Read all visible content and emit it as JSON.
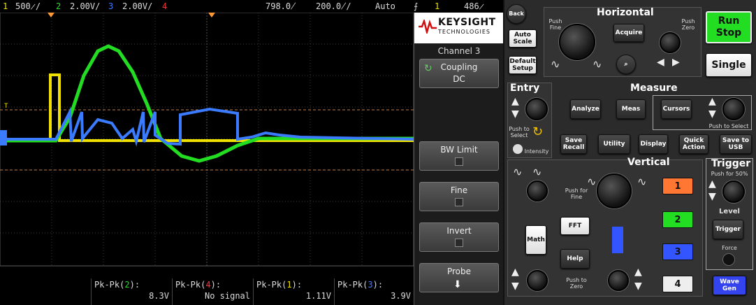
{
  "status": {
    "ch1": "1",
    "ch1_scale": "500̷/",
    "ch2": "2",
    "ch2_scale": "2.00V/",
    "ch3": "3",
    "ch3_scale": "2.00V/",
    "ch4": "4",
    "delay": "798.0̸",
    "timebase": "200.0̸/",
    "trigger_mode": "Auto",
    "trigger_icon": "⨍",
    "trigger_src": "1",
    "trigger_level": "486̷"
  },
  "measurements": [
    {
      "name_prefix": "Pk-Pk(",
      "ch": "2",
      "name_suffix": "):",
      "value": "8.3V"
    },
    {
      "name_prefix": "Pk-Pk(",
      "ch": "4",
      "name_suffix": "):",
      "value": "No signal"
    },
    {
      "name_prefix": "Pk-Pk(",
      "ch": "1",
      "name_suffix": "):",
      "value": "1.11V"
    },
    {
      "name_prefix": "Pk-Pk(",
      "ch": "3",
      "name_suffix": "):",
      "value": "3.9V"
    }
  ],
  "softmenu": {
    "brand": "KEYSIGHT",
    "brand_sub": "TECHNOLOGIES",
    "title": "Channel 3",
    "keys": [
      {
        "label": "Coupling",
        "value": "DC"
      },
      {
        "label": "BW Limit",
        "value": ""
      },
      {
        "label": "Fine",
        "value": ""
      },
      {
        "label": "Invert",
        "value": ""
      },
      {
        "label": "Probe",
        "value": ""
      }
    ]
  },
  "panel": {
    "back": "Back",
    "horizontal": "Horizontal",
    "push_fine": "Push Fine",
    "push_zero": "Push Zero",
    "acquire": "Acquire",
    "auto_scale": "Auto Scale",
    "default_setup": "Default Setup",
    "run_stop": "Run Stop",
    "single": "Single",
    "entry": "Entry",
    "push_to_select": "Push to Select",
    "intensity": "Intensity",
    "measure": "Measure",
    "analyze": "Analyze",
    "meas": "Meas",
    "cursors": "Cursors",
    "push_to_select_2": "Push to Select",
    "save_recall": "Save Recall",
    "utility": "Utility",
    "display": "Display",
    "quick_action": "Quick Action",
    "save_to_usb": "Save to USB",
    "vertical": "Vertical",
    "push_for_fine": "Push for Fine",
    "push_to_zero": "Push to Zero",
    "fft": "FFT",
    "math": "Math",
    "help": "Help",
    "ch_buttons": [
      "1",
      "2",
      "3",
      "4"
    ],
    "trigger": "Trigger",
    "push_for_50": "Push for 50%",
    "level": "Level",
    "trigger_btn": "Trigger",
    "force": "Force",
    "wave_gen": "Wave Gen"
  },
  "colors": {
    "ch1": "#f0e000",
    "ch2": "#22dd22",
    "ch3": "#3a7bff",
    "ch4": "#ff3333",
    "ch1_btn": "#ff7733",
    "ch2_btn": "#22dd22",
    "ch3_btn": "#3355ff",
    "ch4_btn": "#eeeeee",
    "run_stop": "#22dd22"
  }
}
